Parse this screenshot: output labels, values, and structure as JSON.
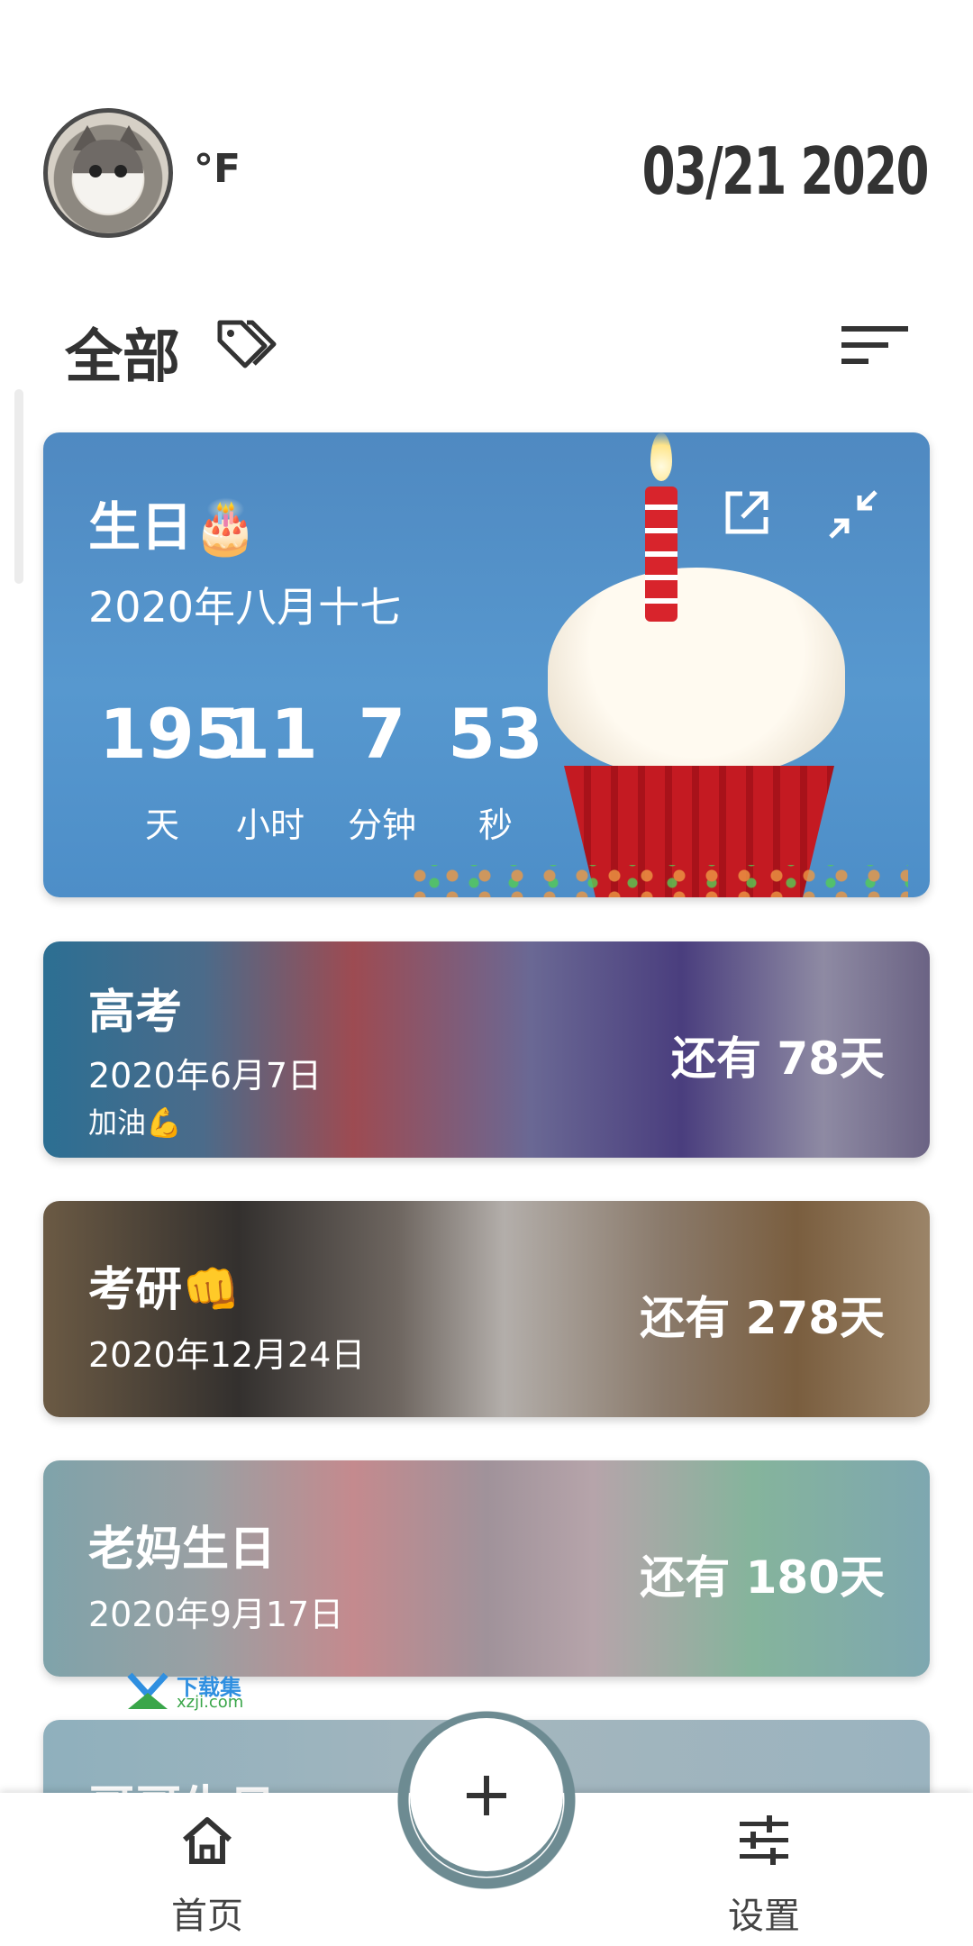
{
  "header": {
    "unit": "°F",
    "date": "03/21 2020"
  },
  "filter": {
    "label": "全部"
  },
  "cards": [
    {
      "title": "生日🎂",
      "date": "2020年八月十七",
      "countdown": [
        {
          "value": "195",
          "label": "天"
        },
        {
          "value": "11",
          "label": "小时"
        },
        {
          "value": "7",
          "label": "分钟"
        },
        {
          "value": "53",
          "label": "秒"
        }
      ]
    },
    {
      "title": "高考",
      "date": "2020年6月7日",
      "note": "加油💪",
      "remain": "还有 78天"
    },
    {
      "title": "考研👊",
      "date": "2020年12月24日",
      "remain": "还有 278天"
    },
    {
      "title": "老妈生日",
      "date": "2020年9月17日",
      "remain": "还有 180天"
    },
    {
      "title": "哥哥生日"
    }
  ],
  "watermark": {
    "line1": "下载集",
    "line2": "xzji.com"
  },
  "nav": {
    "home_label": "首页",
    "settings_label": "设置"
  },
  "colors": {
    "text_dark": "#333333",
    "fab_ring": "#6d8b92"
  }
}
